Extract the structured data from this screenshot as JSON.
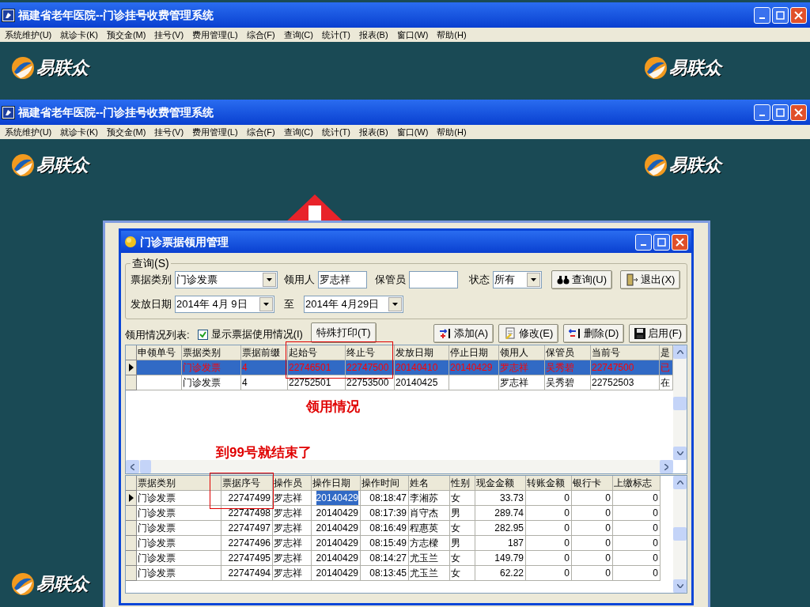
{
  "windows": [
    {
      "title": "福建省老年医院--门诊挂号收费管理系统",
      "menu": [
        "系统维护(U)",
        "就诊卡(K)",
        "预交金(M)",
        "挂号(V)",
        "费用管理(L)",
        "综合(F)",
        "查询(C)",
        "统计(T)",
        "报表(B)",
        "窗口(W)",
        "帮助(H)"
      ],
      "logos": [
        "易联众",
        "易联众"
      ]
    },
    {
      "title": "福建省老年医院--门诊挂号收费管理系统",
      "menu": [
        "系统维护(U)",
        "就诊卡(K)",
        "预交金(M)",
        "挂号(V)",
        "费用管理(L)",
        "综合(F)",
        "查询(C)",
        "统计(T)",
        "报表(B)",
        "窗口(W)",
        "帮助(H)"
      ],
      "logos": [
        "易联众",
        "易联众",
        "易联众"
      ]
    }
  ],
  "dialog": {
    "title": "门诊票据领用管理",
    "query": {
      "legend": "查询(S)",
      "type_label": "票据类别",
      "type_value": "门诊发票",
      "user_label": "领用人",
      "user_value": "罗志祥",
      "keeper_label": "保管员",
      "status_label": "状态",
      "status_value": "所有",
      "search_button": "查询(U)",
      "exit_button": "退出(X)",
      "date_label": "发放日期",
      "date_from": "2014年 4月 9日",
      "to_label": "至",
      "date_to": "2014年 4月29日"
    },
    "list_label": "领用情况列表:",
    "show_usage": {
      "label": "显示票据使用情况(I)",
      "checked": true
    },
    "print_button": "特殊打印(T)",
    "toolbar": [
      {
        "kind": "add",
        "label": "添加(A)"
      },
      {
        "kind": "edit",
        "label": "修改(E)"
      },
      {
        "kind": "delete",
        "label": "删除(D)"
      },
      {
        "kind": "enable",
        "label": "启用(F)"
      }
    ],
    "grid1": {
      "columns": [
        "申领单号",
        "票据类别",
        "票据前缀",
        "起始号",
        "终止号",
        "发放日期",
        "停止日期",
        "领用人",
        "保管员",
        "当前号",
        "是"
      ],
      "rows": [
        {
          "selected": true,
          "cells": [
            "",
            "门诊发票",
            "4",
            "22746501",
            "22747500",
            "20140410",
            "20140429",
            "罗志祥",
            "吴秀碧",
            "22747500",
            "已"
          ]
        },
        {
          "selected": false,
          "cells": [
            "",
            "门诊发票",
            "4",
            "22752501",
            "22753500",
            "20140425",
            "",
            "罗志祥",
            "吴秀碧",
            "22752503",
            "在"
          ]
        }
      ]
    },
    "annotations": [
      "领用情况",
      "到99号就结束了"
    ],
    "grid2": {
      "columns": [
        "票据类别",
        "票据序号",
        "操作员",
        "操作日期",
        "操作时间",
        "姓名",
        "性别",
        "现金金额",
        "转账金额",
        "银行卡",
        "上缴标志"
      ],
      "rows": [
        {
          "selected": true,
          "cells": [
            "门诊发票",
            "22747499",
            "罗志祥",
            {
              "text": "20140429",
              "focused": true
            },
            "08:18:47",
            "李湘苏",
            "女",
            "33.73",
            "0",
            "0",
            "0"
          ]
        },
        {
          "selected": false,
          "cells": [
            "门诊发票",
            "22747498",
            "罗志祥",
            "20140429",
            "08:17:39",
            "肖守杰",
            "男",
            "289.74",
            "0",
            "0",
            "0"
          ]
        },
        {
          "selected": false,
          "cells": [
            "门诊发票",
            "22747497",
            "罗志祥",
            "20140429",
            "08:16:49",
            "程惠英",
            "女",
            "282.95",
            "0",
            "0",
            "0"
          ]
        },
        {
          "selected": false,
          "cells": [
            "门诊发票",
            "22747496",
            "罗志祥",
            "20140429",
            "08:15:49",
            "方志樑",
            "男",
            "187",
            "0",
            "0",
            "0"
          ]
        },
        {
          "selected": false,
          "cells": [
            "门诊发票",
            "22747495",
            "罗志祥",
            "20140429",
            "08:14:27",
            "尤玉兰",
            "女",
            "149.79",
            "0",
            "0",
            "0"
          ]
        },
        {
          "selected": false,
          "cells": [
            "门诊发票",
            "22747494",
            "罗志祥",
            "20140429",
            "08:13:45",
            "尤玉兰",
            "女",
            "62.22",
            "0",
            "0",
            "0"
          ]
        }
      ]
    }
  }
}
